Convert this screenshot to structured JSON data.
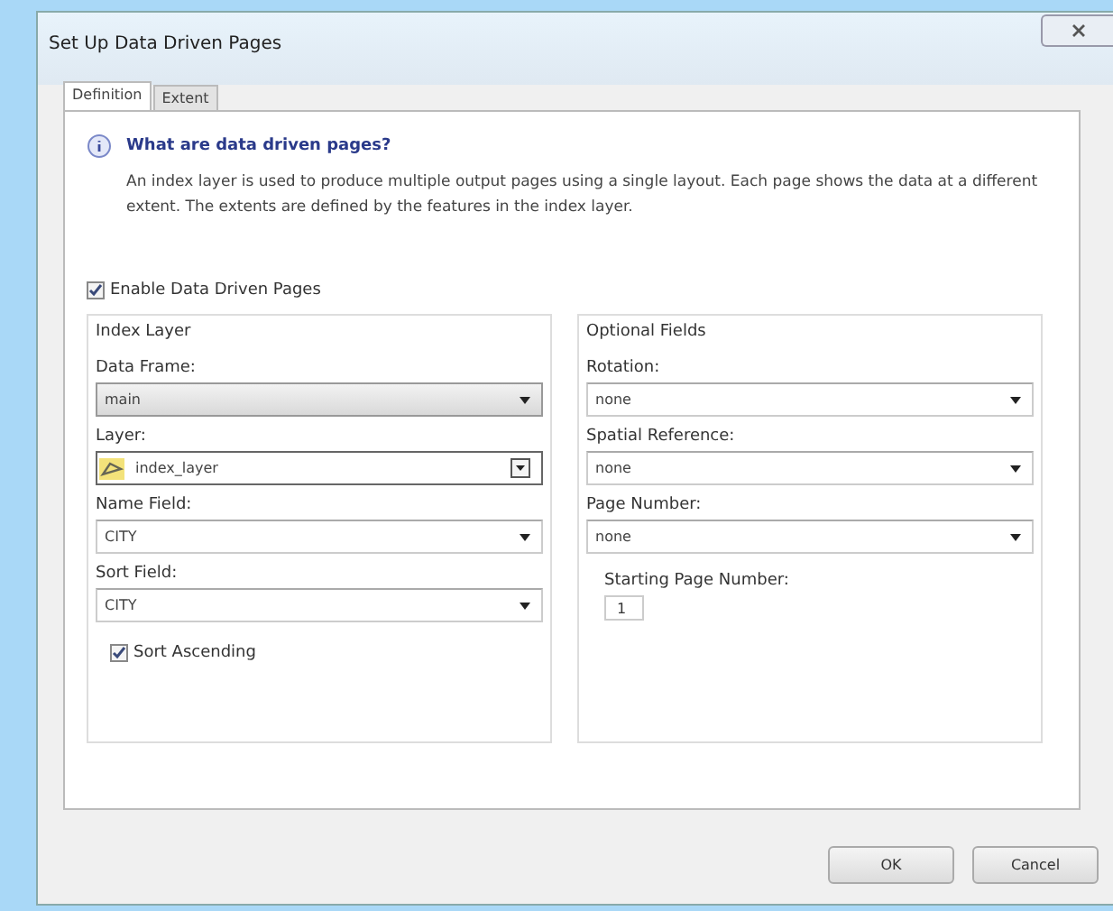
{
  "window": {
    "title": "Set Up Data Driven Pages"
  },
  "tabs": [
    {
      "label": "Definition",
      "selected": true
    },
    {
      "label": "Extent",
      "selected": false
    }
  ],
  "info": {
    "heading": "What are data driven pages?",
    "text": "An index layer is used to produce multiple output pages using a single layout.  Each page shows the data at a different extent.  The extents are defined by the features in the index layer."
  },
  "enable": {
    "label": "Enable Data Driven Pages",
    "checked": true
  },
  "index_layer": {
    "title": "Index Layer",
    "fields": [
      {
        "label": "Data Frame:",
        "value": "main",
        "kind": "shaded"
      },
      {
        "label": "Layer:",
        "value": "index_layer",
        "kind": "layer"
      },
      {
        "label": "Name Field:",
        "value": "CITY",
        "kind": "plain"
      },
      {
        "label": "Sort Field:",
        "value": "CITY",
        "kind": "plain"
      }
    ],
    "sort_ascending": {
      "label": "Sort Ascending",
      "checked": true
    }
  },
  "optional_fields": {
    "title": "Optional Fields",
    "fields": [
      {
        "label": "Rotation:",
        "value": "none",
        "kind": "plain"
      },
      {
        "label": "Spatial Reference:",
        "value": "none",
        "kind": "plain"
      },
      {
        "label": "Page Number:",
        "value": "none",
        "kind": "plain"
      }
    ],
    "starting_page": {
      "label": "Starting Page Number:",
      "value": "1"
    }
  },
  "buttons": [
    "OK",
    "Cancel"
  ]
}
